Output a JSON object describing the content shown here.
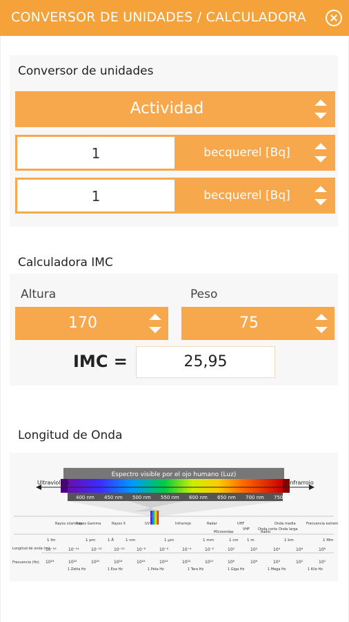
{
  "header": {
    "title": "CONVERSOR DE UNIDADES / CALCULADORA"
  },
  "converter": {
    "title": "Conversor de unidades",
    "category": "Actividad",
    "row1": {
      "value": "1",
      "unit": "becquerel [Bq]"
    },
    "row2": {
      "value": "1",
      "unit": "becquerel [Bq]"
    }
  },
  "bmi": {
    "title": "Calculadora IMC",
    "height_label": "Altura",
    "weight_label": "Peso",
    "height_value": "170",
    "weight_value": "75",
    "result_label": "IMC =",
    "result_value": "25,95"
  },
  "wavelength": {
    "title": "Longitud de Onda",
    "visible_title": "Espectro visible por el ojo humano (Luz)",
    "uv_label": "Ultravioleta",
    "ir_label": "Infrarrojo",
    "nm_ticks": [
      "400 nm",
      "450 nm",
      "500 nm",
      "550 nm",
      "600 nm",
      "650 nm",
      "700 nm",
      "750 nm"
    ],
    "bands": [
      "Rayos cósmicos",
      "Rayos Gamma",
      "Rayos X",
      "UV",
      "Infrarrojo",
      "Radar",
      "Microondas",
      "UHF",
      "VHF",
      "Radio",
      "Onda corta",
      "Onda media",
      "Onda larga",
      "Frecuencia extremadamente baja"
    ],
    "row_labels": [
      "Longitud de onda (m)",
      "Frecuencia (Hz)"
    ],
    "freq_units": [
      "1 Zetta Hz",
      "1 Exa Hz",
      "1 Peta Hz",
      "1 Tera Hz",
      "1 Giga Hz",
      "1 Mega Hz",
      "1 Kilo Hz"
    ],
    "length_units": [
      "1 fm",
      "1 pm",
      "1 Å",
      "1 nm",
      "1 µm",
      "1 mm",
      "1 cm",
      "1 m",
      "1 km",
      "1 Mm"
    ],
    "wl_exponents": [
      "10⁻¹⁶",
      "10⁻¹⁴",
      "10⁻¹²",
      "10⁻¹⁰",
      "10⁻⁸",
      "10⁻⁶",
      "10⁻⁴",
      "10⁻²",
      "10⁰",
      "10²",
      "10⁴",
      "10⁶",
      "10⁸"
    ],
    "fq_exponents": [
      "10²⁴",
      "10²²",
      "10²⁰",
      "10¹⁸",
      "10¹⁶",
      "10¹⁴",
      "10¹²",
      "10¹⁰",
      "10⁸",
      "10⁶",
      "10⁴",
      "10²",
      "10⁰"
    ]
  },
  "colors": {
    "accent": "#f5a23a",
    "accent_light": "#f7a74c"
  }
}
